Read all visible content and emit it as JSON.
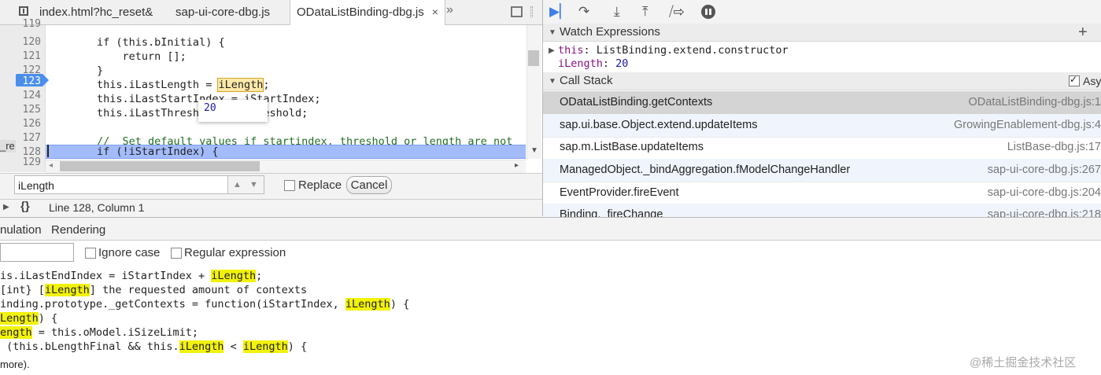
{
  "tabs": [
    {
      "label": "index.html?hc_reset&"
    },
    {
      "label": "sap-ui-core-dbg.js"
    },
    {
      "label": "ODataListBinding-dbg.js",
      "active": true
    }
  ],
  "tab_close_glyph": "×",
  "more_tabs_glyph": "»",
  "editor": {
    "lines": [
      {
        "num": "119",
        "text": ""
      },
      {
        "num": "120",
        "text": "        if (this.bInitial) {"
      },
      {
        "num": "121",
        "text": "            return [];"
      },
      {
        "num": "122",
        "text": "        }"
      },
      {
        "num": "123",
        "pre": "        this.iLastLength = ",
        "highlight": "iLength",
        "post": ";"
      },
      {
        "num": "124",
        "text": "        this.iLastStartIndex = iStartIndex;"
      },
      {
        "num": "125",
        "text": "        this.iLastThreshold = iThreshold;"
      },
      {
        "num": "126",
        "text": ""
      },
      {
        "num": "127",
        "text": "        //  Set default values if startindex, threshold or length are not"
      },
      {
        "num": "128",
        "text": "        if (!iStartIndex) {"
      },
      {
        "num": "129",
        "text": ""
      }
    ],
    "tooltip_value": "20",
    "side_fragment": "_re"
  },
  "find_bar": {
    "search_value": "iLength",
    "replace_label": "Replace",
    "cancel_label": "Cancel",
    "up_glyph": "▲",
    "down_glyph": "▼"
  },
  "status": {
    "braces": "{}",
    "position": "Line 128, Column 1"
  },
  "debugger": {
    "watch": {
      "title": "Watch Expressions",
      "add_glyph": "+",
      "items": [
        {
          "name": "this",
          "value": "ListBinding.extend.constructor"
        },
        {
          "name": "iLength",
          "value": "20"
        }
      ]
    },
    "call_stack": {
      "title": "Call Stack",
      "async_label": "Asy",
      "frames": [
        {
          "fn": "ODataListBinding.getContexts",
          "loc": "ODataListBinding-dbg.js:1"
        },
        {
          "fn": "sap.ui.base.Object.extend.updateItems",
          "loc": "GrowingEnablement-dbg.js:4"
        },
        {
          "fn": "sap.m.ListBase.updateItems",
          "loc": "ListBase-dbg.js:17"
        },
        {
          "fn": "ManagedObject._bindAggregation.fModelChangeHandler",
          "loc": "sap-ui-core-dbg.js:267"
        },
        {
          "fn": "EventProvider.fireEvent",
          "loc": "sap-ui-core-dbg.js:204"
        },
        {
          "fn": "Binding._fireChange",
          "loc": "sap-ui-core-dbg.js:218"
        }
      ]
    }
  },
  "drawer": {
    "tabs": [
      {
        "label": "nulation"
      },
      {
        "label": "Rendering"
      }
    ],
    "ignore_case_label": "Ignore case",
    "regex_label": "Regular expression",
    "results": [
      {
        "parts": [
          {
            "t": "is.iLastEndIndex = iStartIndex + "
          },
          {
            "t": "iLength",
            "h": true
          },
          {
            "t": ";"
          }
        ]
      },
      {
        "parts": [
          {
            "t": "[int} ["
          },
          {
            "t": "iLength",
            "h": true
          },
          {
            "t": "] the requested amount of contexts"
          }
        ]
      },
      {
        "parts": [
          {
            "t": "inding.prototype._getContexts = function(iStartIndex, "
          },
          {
            "t": "iLength",
            "h": true
          },
          {
            "t": ") {"
          }
        ]
      },
      {
        "parts": [
          {
            "t": "Length",
            "h": true
          },
          {
            "t": ") {"
          }
        ]
      },
      {
        "parts": [
          {
            "t": "ength",
            "h": true
          },
          {
            "t": " = this.oModel.iSizeLimit;"
          }
        ]
      },
      {
        "parts": [
          {
            "t": " (this.bLengthFinal && this."
          },
          {
            "t": "iLength",
            "h": true
          },
          {
            "t": " < "
          },
          {
            "t": "iLength",
            "h": true
          },
          {
            "t": ") {"
          }
        ]
      }
    ],
    "more_text": "more)."
  },
  "watermark": "@稀土掘金技术社区",
  "colors": {
    "breakpoint": "#4a8eed",
    "exec_line": "#a2bbfb",
    "search_highlight": "#f2f20a",
    "resume_icon": "#3f7fe8"
  }
}
